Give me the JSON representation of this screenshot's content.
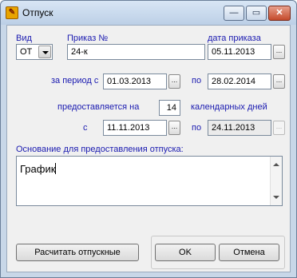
{
  "window": {
    "title": "Отпуск",
    "icon_glyph": "✎",
    "minimize_glyph": "—",
    "maximize_glyph": "▭",
    "close_glyph": "✕"
  },
  "form": {
    "vid": {
      "label": "Вид",
      "value": "ОТ"
    },
    "prikaz": {
      "label": "Приказ №",
      "value": "24-к"
    },
    "data_prikaza": {
      "label": "дата приказа",
      "value": "05.11.2013",
      "button": "..."
    },
    "period": {
      "label_from": "за период с",
      "from_value": "01.03.2013",
      "from_button": "...",
      "label_to": "по",
      "to_value": "28.02.2014",
      "to_button": "..."
    },
    "days": {
      "label": "предоставляется на",
      "value": "14",
      "unit_label": "календарных дней"
    },
    "leave": {
      "label_from": "с",
      "from_value": "11.11.2013",
      "from_button": "...",
      "label_to": "по",
      "to_value": "24.11.2013",
      "to_button": "..."
    },
    "osnovanie": {
      "label": "Основание для предоставления отпуска:",
      "value": "График"
    }
  },
  "buttons": {
    "calc": "Расчитать отпускные",
    "ok": "OK",
    "cancel": "Отмена"
  }
}
